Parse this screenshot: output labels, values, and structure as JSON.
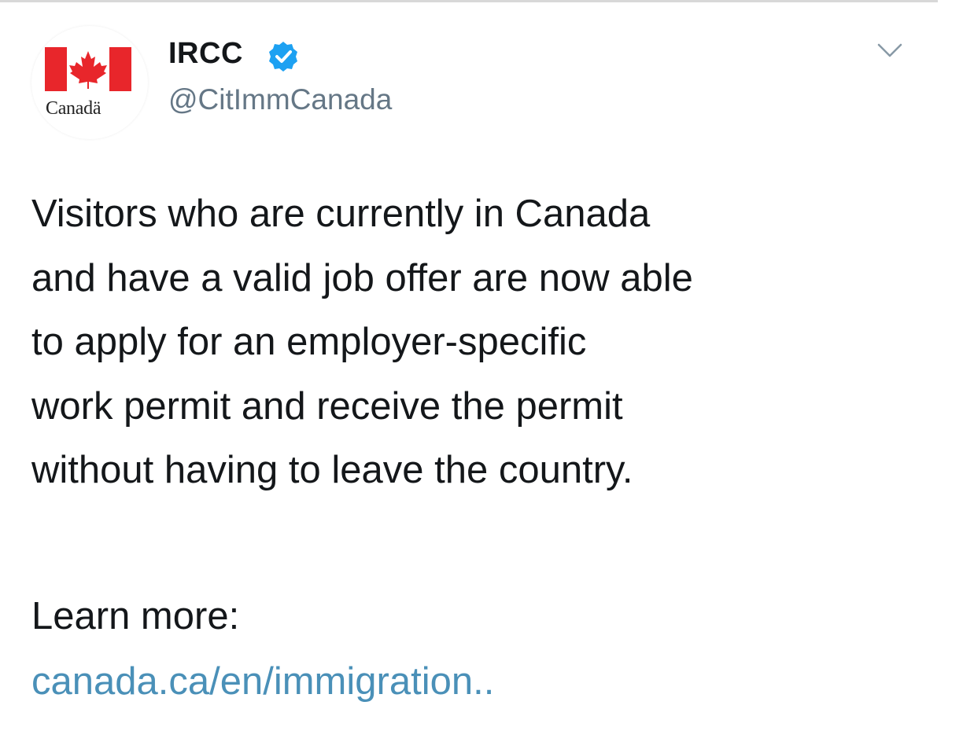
{
  "account": {
    "display_name": "IRCC",
    "handle": "@CitImmCanada",
    "verified": true,
    "avatar_wordmark": "Canadä",
    "avatar_icon": "canada-flag-icon"
  },
  "tweet": {
    "lines": [
      "Visitors who are currently in Canada",
      "and have a valid job offer are now able",
      "to apply for an employer-specific",
      "work permit and receive the permit",
      "without having to leave the country."
    ],
    "learn_more": "Learn more:",
    "link_text": "canada.ca/en/immigration.."
  },
  "icons": {
    "verified": "verified-badge-icon",
    "menu": "chevron-down-icon"
  },
  "colors": {
    "flag_red": "#e8262b",
    "verified_blue": "#1da1f2",
    "link": "#4a90b8",
    "handle": "#657786",
    "text": "#14171a"
  }
}
